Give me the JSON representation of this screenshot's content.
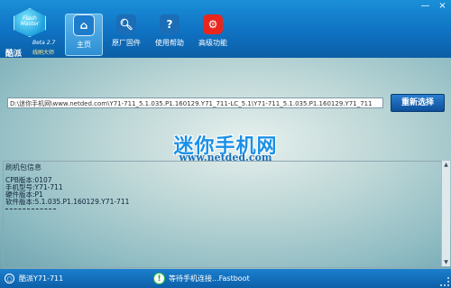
{
  "logo": {
    "badge_text": "Flash Master",
    "version": "Beta 2.7",
    "name": "酷派",
    "subtitle": "线刷大师"
  },
  "nav": {
    "home": "主页",
    "firmware": "原厂固件",
    "help": "使用帮助",
    "advanced": "高级功能"
  },
  "window_controls": {
    "minimize": "—",
    "close": "×"
  },
  "firmware_path": "D:\\迷你手机网\\www.netded.com\\Y71-711_5.1.035.P1.160129.Y71_711-LC_5.1\\Y71-711_5.1.035.P1.160129.Y71_711",
  "reselect_button": "重新选择",
  "watermark": {
    "text": "迷你手机网",
    "url": "www.netded.com"
  },
  "info": {
    "title": "刷机包信息",
    "lines": [
      "CPB版本:0107",
      "手机型号:Y71-711",
      "硬件版本:P1",
      "软件版本:5.1.035.P1.160129.Y71-711"
    ]
  },
  "status": {
    "model": "酷派Y71-711",
    "state": "等待手机连接...Fastboot"
  },
  "colors": {
    "header_blue": "#0f72c2",
    "accent_red": "#e8261c",
    "watermark_blue": "#1a90e8"
  },
  "icons": {
    "home": "home-icon",
    "firmware": "search-icon",
    "help": "help-icon",
    "advanced": "gear-icon"
  }
}
